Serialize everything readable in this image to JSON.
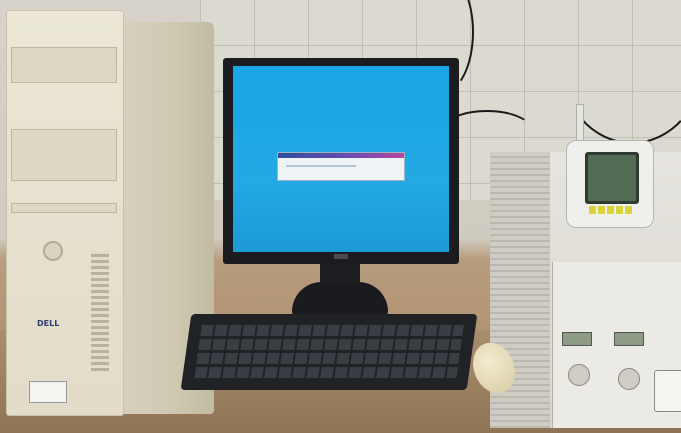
{
  "scene": {
    "description_name": "office-desk-photo"
  },
  "tower": {
    "brand_label": "DELL"
  },
  "monitor": {
    "screen_color": "#1aa5e6"
  },
  "colors": {
    "wall": "#dcd9d1",
    "desk": "#a98e6e",
    "tower": "#ebe6d5",
    "monitor": "#1b1c1f",
    "dialog_bar": "#6f4bb0"
  }
}
